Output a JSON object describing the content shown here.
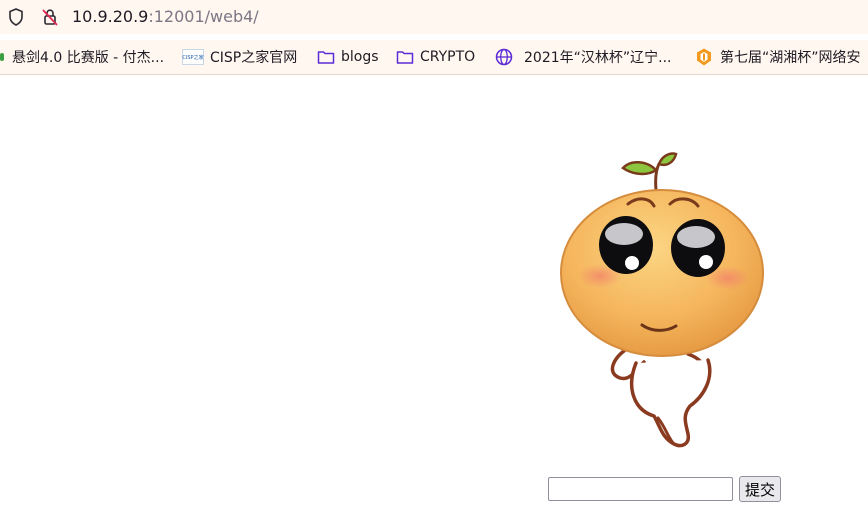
{
  "address_bar": {
    "host": "10.9.20.9",
    "rest": ":12001/web4/"
  },
  "bookmarks": {
    "items": [
      {
        "label": "悬剑4.0 比赛版 - 付杰...",
        "icon": "leaf-icon"
      },
      {
        "label": "CISP之家官网",
        "icon": "cisp-logo-icon",
        "icon_text": "CISP之家"
      },
      {
        "label": "blogs",
        "icon": "folder-icon"
      },
      {
        "label": "CRYPTO",
        "icon": "folder-icon"
      },
      {
        "label": "2021年“汉林杯”辽宁...",
        "icon": "globe-icon"
      },
      {
        "label": "第七届“湖湘杯”网络安",
        "icon": "shield-logo-icon"
      }
    ]
  },
  "form": {
    "input_value": "",
    "submit_label": "提交"
  },
  "colors": {
    "browser_chrome": "#fff7f0",
    "folder_icon": "#5b2bd6",
    "mascot_body": "#f4b45a"
  }
}
